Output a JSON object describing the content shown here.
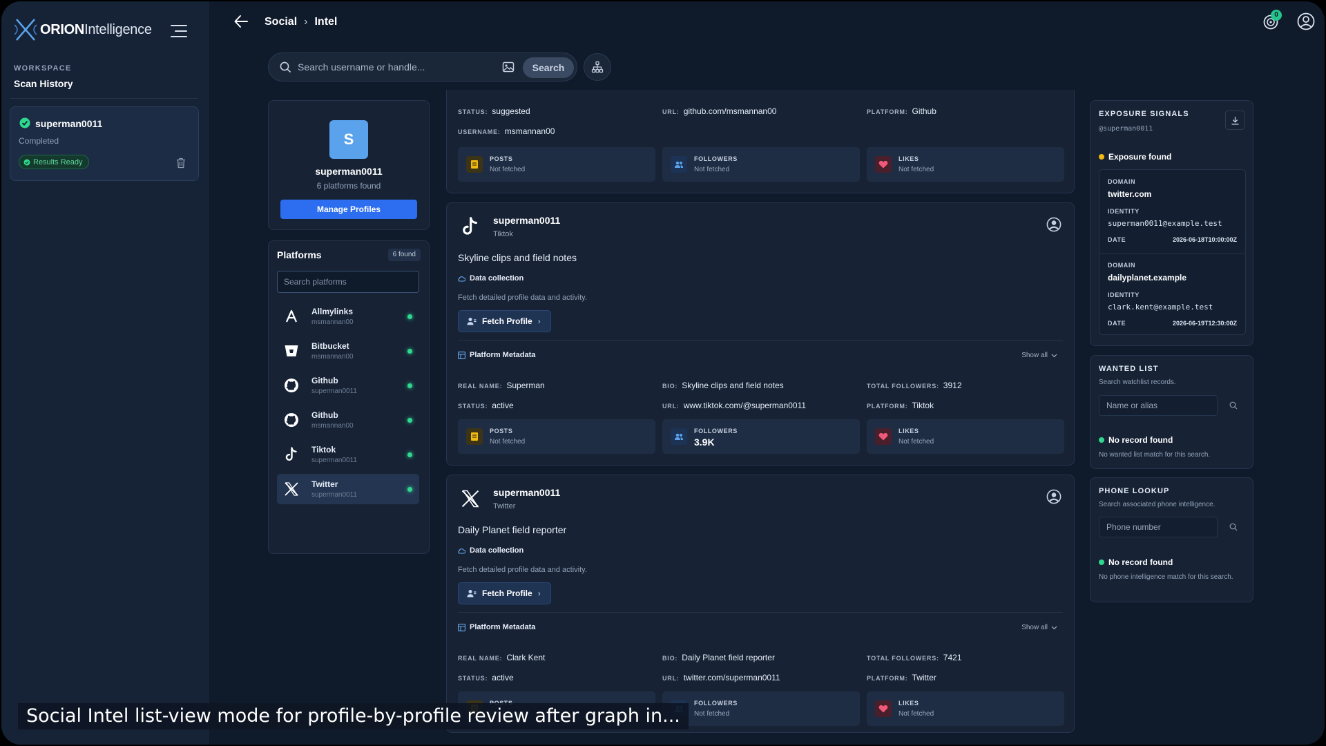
{
  "app": {
    "brand_bold": "ORION",
    "brand_light": "Intelligence"
  },
  "sidebar": {
    "section_label": "WORKSPACE",
    "section_title": "Scan History",
    "scan": {
      "name": "superman0011",
      "status": "Completed",
      "badge": "Results Ready"
    }
  },
  "topbar": {
    "crumb_1": "Social",
    "crumb_2": "Intel",
    "notification_count": "0"
  },
  "search": {
    "placeholder": "Search username or handle...",
    "button": "Search"
  },
  "profile": {
    "initial": "S",
    "name": "superman0011",
    "platform_count": "6 platforms found",
    "manage_button": "Manage Profiles"
  },
  "platforms": {
    "title": "Platforms",
    "badge": "6 found",
    "search_placeholder": "Search platforms",
    "items": [
      {
        "name": "Allmylinks",
        "user": "msmannan00",
        "icon": "allmylinks-icon"
      },
      {
        "name": "Bitbucket",
        "user": "msmannan00",
        "icon": "bitbucket-icon"
      },
      {
        "name": "Github",
        "user": "superman0011",
        "icon": "github-icon"
      },
      {
        "name": "Github",
        "user": "msmannan00",
        "icon": "github-icon"
      },
      {
        "name": "Tiktok",
        "user": "superman0011",
        "icon": "tiktok-icon"
      },
      {
        "name": "Twitter",
        "user": "superman0011",
        "icon": "x-twitter-icon"
      }
    ]
  },
  "labels": {
    "status": "STATUS:",
    "url": "URL:",
    "platform": "PLATFORM:",
    "username": "USERNAME:",
    "real_name": "REAL NAME:",
    "bio": "BIO:",
    "total_followers": "TOTAL FOLLOWERS:",
    "posts": "POSTS",
    "followers": "FOLLOWERS",
    "likes": "LIKES",
    "not_fetched": "Not fetched",
    "data_collection": "Data collection",
    "data_collection_sub": "Fetch detailed profile data and activity.",
    "fetch_profile": "Fetch Profile",
    "platform_metadata": "Platform Metadata",
    "show_all": "Show all"
  },
  "results": {
    "github": {
      "status": "suggested",
      "url": "github.com/msmannan00",
      "platform": "Github",
      "username": "msmannan00"
    },
    "tiktok": {
      "name": "superman0011",
      "platform_label": "Tiktok",
      "bio_line": "Skyline clips and field notes",
      "real_name": "Superman",
      "bio": "Skyline clips and field notes",
      "total_followers": "3912",
      "status": "active",
      "url": "www.tiktok.com/@superman0011",
      "platform": "Tiktok",
      "followers_value": "3.9K"
    },
    "twitter": {
      "name": "superman0011",
      "platform_label": "Twitter",
      "bio_line": "Daily Planet field reporter",
      "real_name": "Clark Kent",
      "bio": "Daily Planet field reporter",
      "total_followers": "7421",
      "status": "active",
      "url": "twitter.com/superman0011",
      "platform": "Twitter"
    }
  },
  "exposure": {
    "title": "EXPOSURE SIGNALS",
    "handle": "@superman0011",
    "found": "Exposure found",
    "domain_label": "DOMAIN",
    "identity_label": "IDENTITY",
    "date_label": "DATE",
    "entries": [
      {
        "domain": "twitter.com",
        "identity": "superman0011@example.test",
        "date": "2026-06-18T10:00:00Z"
      },
      {
        "domain": "dailyplanet.example",
        "identity": "clark.kent@example.test",
        "date": "2026-06-19T12:30:00Z"
      }
    ]
  },
  "wanted": {
    "title": "WANTED LIST",
    "subtitle": "Search watchlist records.",
    "placeholder": "Name or alias",
    "result": "No record found",
    "result_sub": "No wanted list match for this search."
  },
  "phone": {
    "title": "PHONE LOOKUP",
    "subtitle": "Search associated phone intelligence.",
    "placeholder": "Phone number",
    "result": "No record found",
    "result_sub": "No phone intelligence match for this search."
  },
  "caption": "Social Intel list-view mode for profile-by-profile review after graph in..."
}
